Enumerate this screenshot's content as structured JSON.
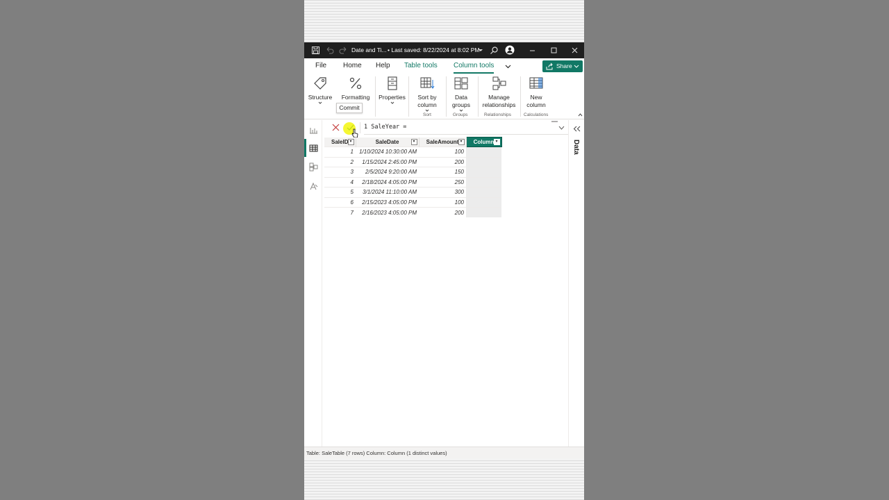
{
  "window": {
    "title": "Date and Ti...",
    "saved_status": "• Last saved: 8/22/2024 at 8:02 PM"
  },
  "tabs": [
    "File",
    "Home",
    "Help",
    "Table tools",
    "Column tools"
  ],
  "share_label": "Share",
  "ribbon": {
    "structure": "Structure",
    "formatting": "Formatting",
    "properties": "Properties",
    "sort_by_column_1": "Sort by",
    "sort_by_column_2": "column",
    "data_groups_1": "Data",
    "data_groups_2": "groups",
    "manage_rel_1": "Manage",
    "manage_rel_2": "relationships",
    "new_column_1": "New",
    "new_column_2": "column",
    "group_sort": "Sort",
    "group_groups": "Groups",
    "group_relationships": "Relationships",
    "group_calculations": "Calculations"
  },
  "tooltip": "Commit",
  "formula": "1  SaleYear =",
  "data_pane_label": "Data",
  "table": {
    "headers": [
      "SaleID",
      "SaleDate",
      "SaleAmount",
      "Column"
    ],
    "rows": [
      [
        "1",
        "1/10/2024 10:30:00 AM",
        "100"
      ],
      [
        "2",
        "1/15/2024 2:45:00 PM",
        "200"
      ],
      [
        "3",
        "2/5/2024 9:20:00 AM",
        "150"
      ],
      [
        "4",
        "2/18/2024 4:05:00 PM",
        "250"
      ],
      [
        "5",
        "3/1/2024 11:10:00 AM",
        "300"
      ],
      [
        "6",
        "2/15/2023 4:05:00 PM",
        "100"
      ],
      [
        "7",
        "2/16/2023 4:05:00 PM",
        "200"
      ]
    ]
  },
  "status_text": "Table: SaleTable (7 rows) Column: Column (1 distinct values)",
  "colors": {
    "accent": "#117865",
    "titlebar": "#1f1f1f"
  }
}
